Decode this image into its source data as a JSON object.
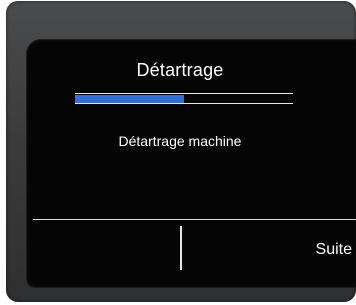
{
  "screen": {
    "title": "Détartrage",
    "subtitle": "Détartrage machine",
    "progress": 0.5
  },
  "softkeys": {
    "left_label": "",
    "right_label": "Suite"
  },
  "colors": {
    "accent": "#2f6fe0",
    "background": "#050505",
    "text": "#ffffff"
  }
}
